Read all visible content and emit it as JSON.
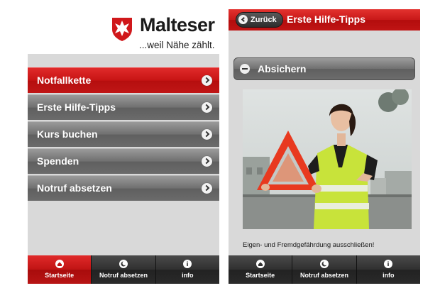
{
  "left": {
    "brand": {
      "name": "Malteser",
      "tagline": "...weil Nähe zählt."
    },
    "menu": [
      {
        "label": "Notfallkette",
        "active": true
      },
      {
        "label": "Erste Hilfe-Tipps",
        "active": false
      },
      {
        "label": "Kurs buchen",
        "active": false
      },
      {
        "label": "Spenden",
        "active": false
      },
      {
        "label": "Notruf absetzen",
        "active": false
      }
    ],
    "tabs": [
      {
        "label": "Startseite",
        "icon": "home-icon",
        "active": true
      },
      {
        "label": "Notruf absetzen",
        "icon": "moon-icon",
        "active": false
      },
      {
        "label": "info",
        "icon": "info-icon",
        "active": false
      }
    ]
  },
  "right": {
    "header": {
      "back_label": "Zurück",
      "title": "Erste Hilfe-Tipps"
    },
    "section": {
      "title": "Absichern",
      "caption": "Eigen- und Fremdgefährdung ausschließen!"
    },
    "tabs": [
      {
        "label": "Startseite",
        "icon": "home-icon",
        "active": false
      },
      {
        "label": "Notruf absetzen",
        "icon": "moon-icon",
        "active": false
      },
      {
        "label": "info",
        "icon": "info-icon",
        "active": false
      }
    ]
  },
  "colors": {
    "accent_red": "#c71414",
    "menu_gray": "#6f6f6f",
    "tabbar_dark": "#2b2b2b",
    "background": "#d9d9d9"
  }
}
